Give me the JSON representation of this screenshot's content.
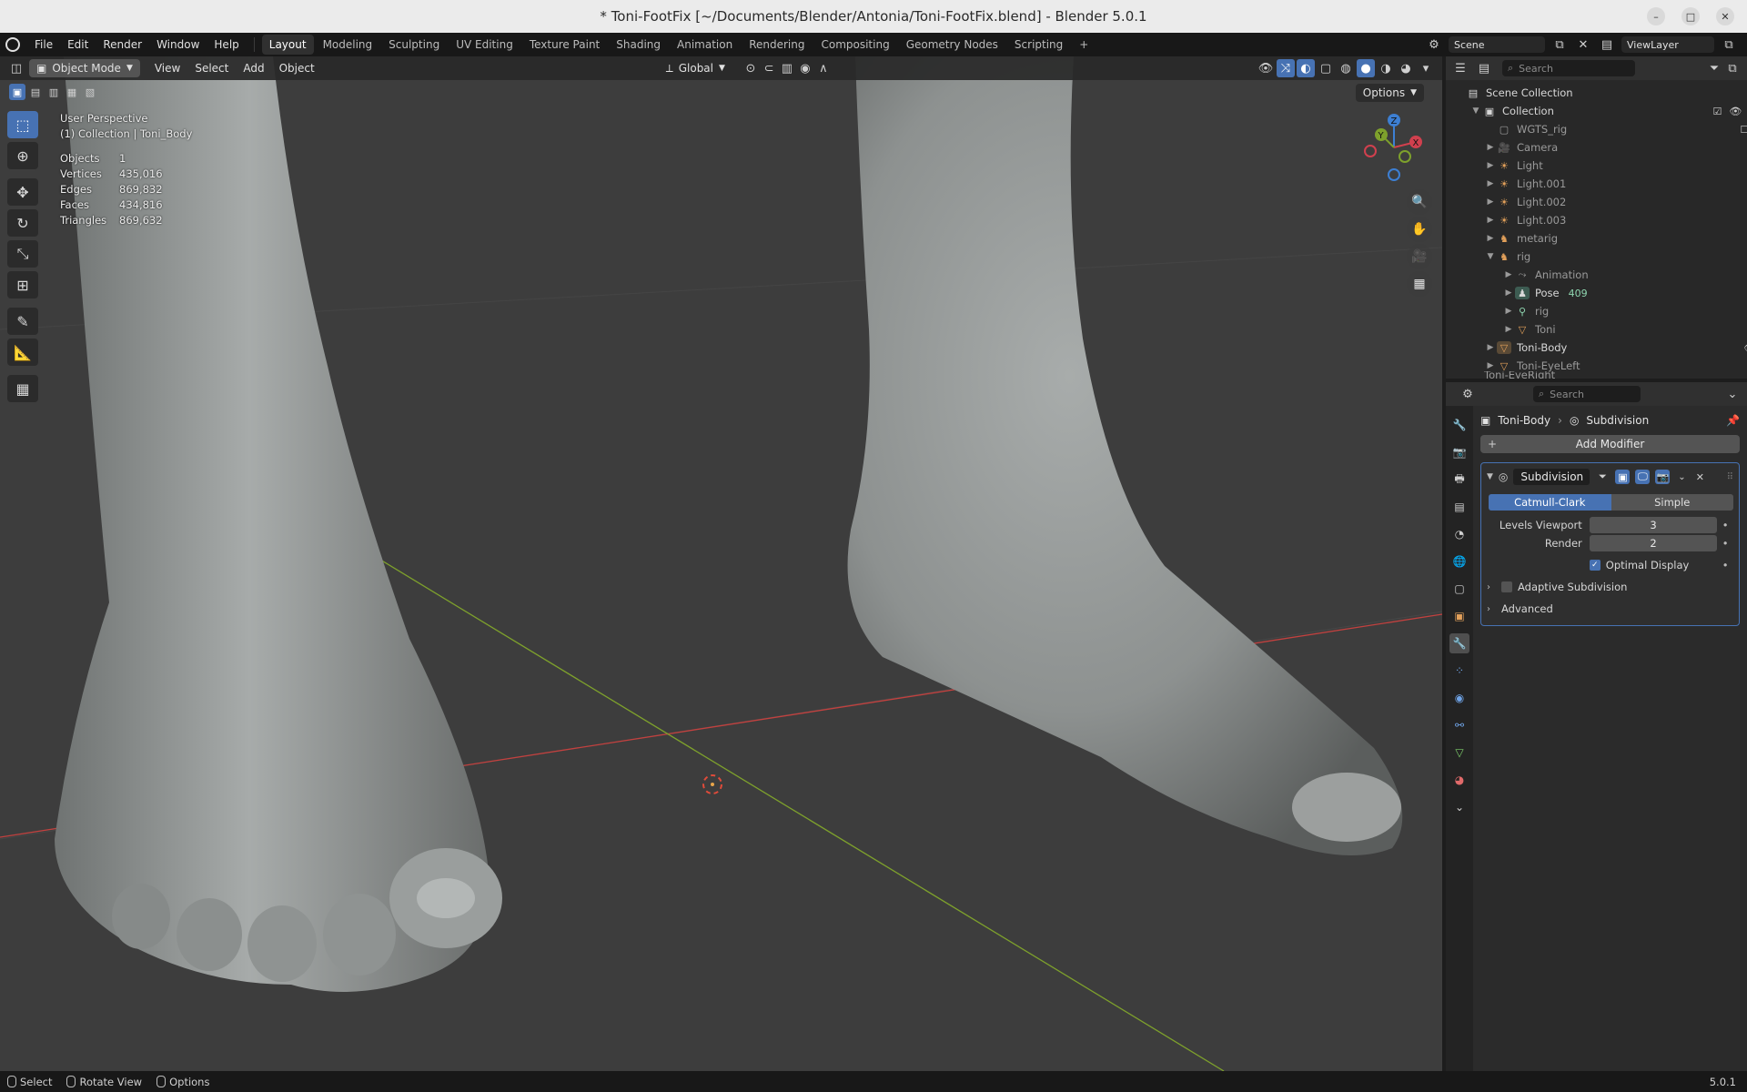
{
  "window": {
    "title": "* Toni-FootFix [~/Documents/Blender/Antonia/Toni-FootFix.blend] - Blender 5.0.1"
  },
  "menubar": {
    "menus": [
      "File",
      "Edit",
      "Render",
      "Window",
      "Help"
    ],
    "workspaces": [
      "Layout",
      "Modeling",
      "Sculpting",
      "UV Editing",
      "Texture Paint",
      "Shading",
      "Animation",
      "Rendering",
      "Compositing",
      "Geometry Nodes",
      "Scripting"
    ],
    "active_workspace": "Layout",
    "add_tab": "+",
    "scene": "Scene",
    "view_layer": "ViewLayer"
  },
  "viewport_header": {
    "mode": "Object Mode",
    "menus": [
      "View",
      "Select",
      "Add",
      "Object"
    ],
    "transform_orientation": "Global",
    "options_label": "Options"
  },
  "viewport_overlay": {
    "perspective": "User Perspective",
    "collection_line": "(1) Collection | Toni_Body",
    "stats": [
      {
        "key": "Objects",
        "value": "1"
      },
      {
        "key": "Vertices",
        "value": "435,016"
      },
      {
        "key": "Edges",
        "value": "869,832"
      },
      {
        "key": "Faces",
        "value": "434,816"
      },
      {
        "key": "Triangles",
        "value": "869,632"
      }
    ],
    "gizmo": {
      "x": "X",
      "y": "Y",
      "z": "Z"
    }
  },
  "outliner": {
    "search_placeholder": "Search",
    "rows": [
      {
        "label": "Scene Collection"
      },
      {
        "label": "Collection"
      },
      {
        "label": "WGTS_rig"
      },
      {
        "label": "Camera"
      },
      {
        "label": "Light"
      },
      {
        "label": "Light.001"
      },
      {
        "label": "Light.002"
      },
      {
        "label": "Light.003"
      },
      {
        "label": "metarig"
      },
      {
        "label": "rig"
      },
      {
        "label": "Animation"
      },
      {
        "label": "Pose",
        "extra": "409"
      },
      {
        "label": "rig"
      },
      {
        "label": "Toni"
      },
      {
        "label": "Toni-Body"
      },
      {
        "label": "Toni-EyeLeft"
      },
      {
        "label": "Toni-EyeRight"
      }
    ]
  },
  "properties": {
    "search_placeholder": "Search",
    "object_name": "Toni-Body",
    "modifier_crumb": "Subdivision",
    "add_modifier": "Add Modifier",
    "modifier": {
      "name": "Subdivision",
      "mode_on": "Catmull-Clark",
      "mode_off": "Simple",
      "levels_viewport_label": "Levels Viewport",
      "levels_viewport": "3",
      "render_label": "Render",
      "render_value": "2",
      "optimal_display": "Optimal Display",
      "adaptive": "Adaptive Subdivision",
      "advanced": "Advanced"
    }
  },
  "statusbar": {
    "items": [
      "Select",
      "Rotate View",
      "Options"
    ],
    "version": "5.0.1"
  },
  "colors": {
    "accent": "#4772b3",
    "viewport_bg": "#3d3d3d",
    "x_axis": "#c2413f",
    "y_axis": "#7ea12c"
  }
}
